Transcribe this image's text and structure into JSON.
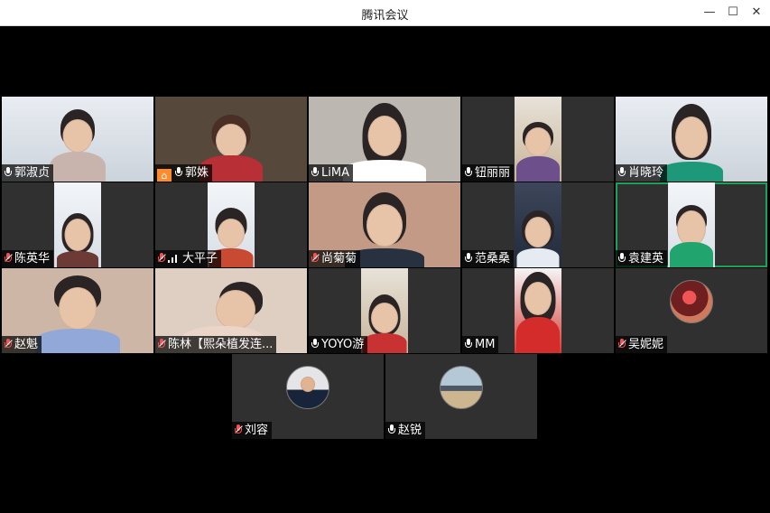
{
  "window": {
    "title": "腾讯会议",
    "minimize": "—",
    "maximize": "☐",
    "close": "✕"
  },
  "participants": [
    {
      "name": "郭淑贞",
      "mic": "on"
    },
    {
      "name": "郭姝",
      "mic": "on",
      "host": true
    },
    {
      "name": "LiMA",
      "mic": "on"
    },
    {
      "name": "钮丽丽",
      "mic": "on"
    },
    {
      "name": "肖晓玲",
      "mic": "on"
    },
    {
      "name": "陈英华",
      "mic": "muted"
    },
    {
      "name": "大平子",
      "mic": "muted",
      "signal": true
    },
    {
      "name": "尚菊菊",
      "mic": "muted"
    },
    {
      "name": "范桑桑",
      "mic": "on"
    },
    {
      "name": "袁建英",
      "mic": "on",
      "active": true
    },
    {
      "name": "赵魁",
      "mic": "muted"
    },
    {
      "name": "陈林【熙朵植发连...",
      "mic": "muted"
    },
    {
      "name": "YOYO游",
      "mic": "on"
    },
    {
      "name": "MM",
      "mic": "on"
    },
    {
      "name": "吴妮妮",
      "mic": "muted"
    },
    {
      "name": "刘容",
      "mic": "muted"
    },
    {
      "name": "赵锐",
      "mic": "on"
    }
  ]
}
